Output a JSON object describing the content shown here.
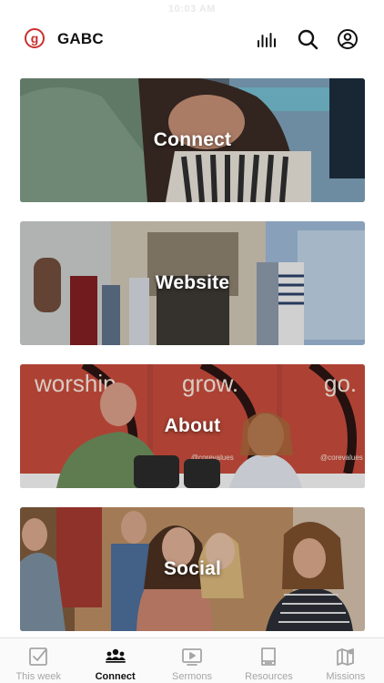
{
  "status": {
    "time": "10:03 AM"
  },
  "header": {
    "logo_letter": "g",
    "title": "GABC"
  },
  "cards": [
    {
      "label": "Connect"
    },
    {
      "label": "Website"
    },
    {
      "label": "About",
      "photo_wall_words": [
        "worship.",
        "grow.",
        "go."
      ],
      "photo_sign_text": "@corevalues"
    },
    {
      "label": "Social"
    }
  ],
  "tabs": [
    {
      "label": "This week",
      "icon": "checkbox-icon",
      "active": false
    },
    {
      "label": "Connect",
      "icon": "people-icon",
      "active": true
    },
    {
      "label": "Sermons",
      "icon": "play-icon",
      "active": false
    },
    {
      "label": "Resources",
      "icon": "book-icon",
      "active": false
    },
    {
      "label": "Missions",
      "icon": "map-icon",
      "active": false
    }
  ],
  "colors": {
    "brand": "#c8302e",
    "inactive_tab": "#a5a5a5",
    "active_tab": "#111111"
  }
}
